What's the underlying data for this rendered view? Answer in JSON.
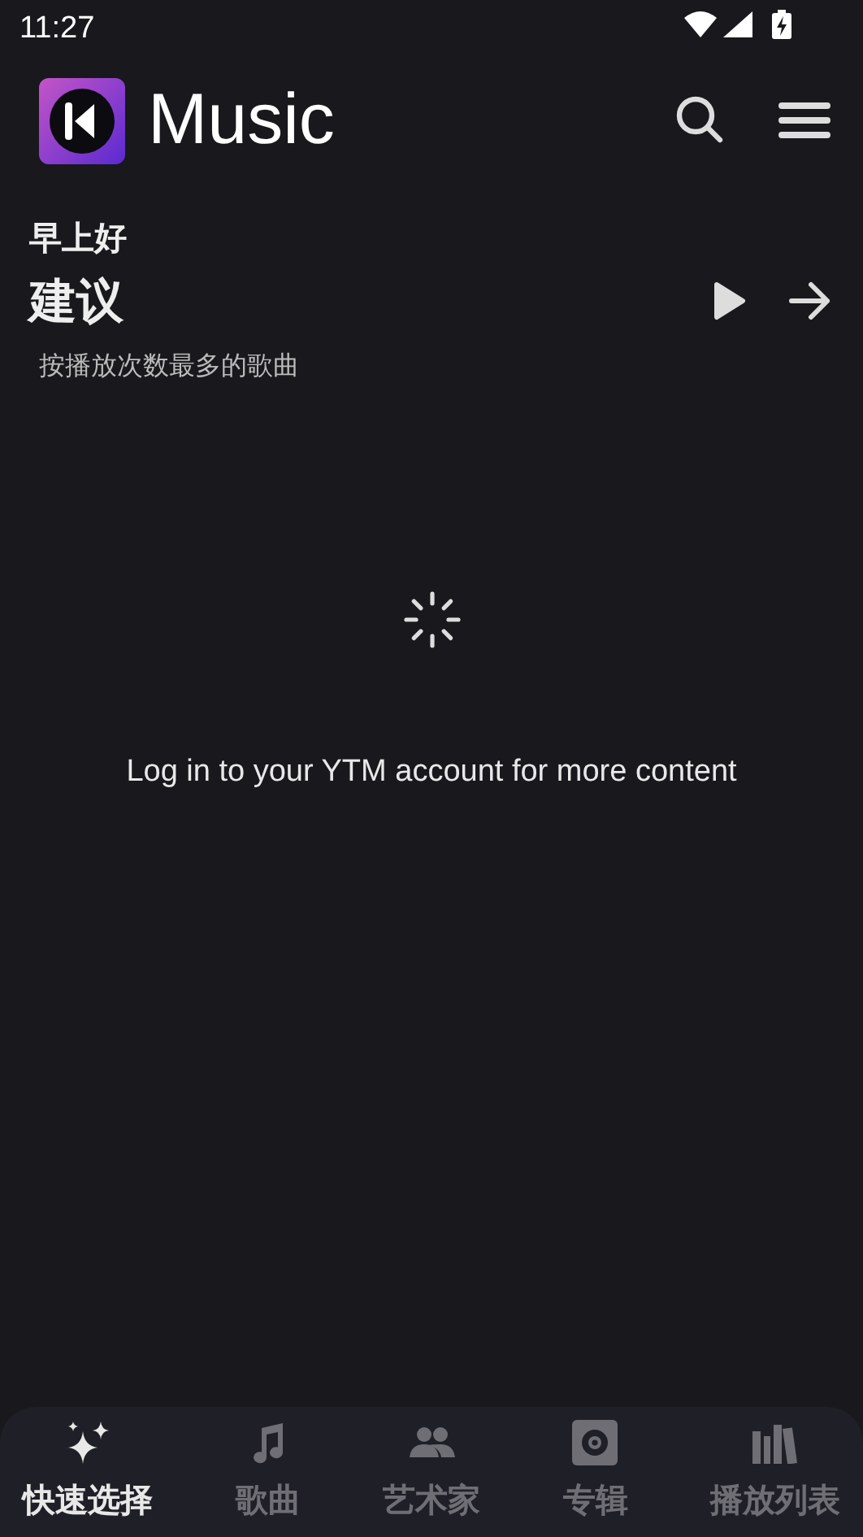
{
  "status_bar": {
    "time": "11:27"
  },
  "header": {
    "app_name": "Music"
  },
  "greeting": "早上好",
  "section": {
    "title": "建议",
    "subtitle": "按播放次数最多的歌曲"
  },
  "loading": true,
  "message": "Log in to your YTM account for more content",
  "nav": [
    {
      "label": "快速选择",
      "kind": "sparkle",
      "selected": true
    },
    {
      "label": "歌曲",
      "kind": "note",
      "selected": false
    },
    {
      "label": "艺术家",
      "kind": "people",
      "selected": false
    },
    {
      "label": "专辑",
      "kind": "album",
      "selected": false
    },
    {
      "label": "播放列表",
      "kind": "library",
      "selected": false
    }
  ]
}
